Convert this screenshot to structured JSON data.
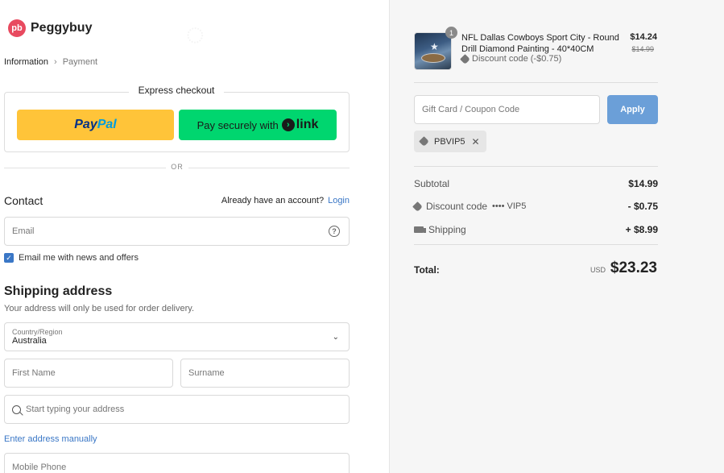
{
  "brand": {
    "name": "Peggybuy",
    "mark": "pb"
  },
  "breadcrumb": {
    "step1": "Information",
    "step2": "Payment"
  },
  "express": {
    "title": "Express checkout",
    "paypal_part1": "Pay",
    "paypal_part2": "Pal",
    "link_label": "Pay securely with",
    "link_word": "link"
  },
  "divider_label": "OR",
  "contact": {
    "heading": "Contact",
    "account_prompt": "Already have an account?",
    "login_label": "Login",
    "email_placeholder": "Email",
    "newsletter_label": "Email me with news and offers"
  },
  "shipping": {
    "heading": "Shipping address",
    "subtitle": "Your address will only be used for order delivery.",
    "country_label": "Country/Region",
    "country_value": "Australia",
    "first_name_placeholder": "First Name",
    "surname_placeholder": "Surname",
    "address_placeholder": "Start typing your address",
    "manual_link": "Enter address manually",
    "phone_placeholder": "Mobile Phone"
  },
  "order": {
    "quantity": "1",
    "product_name": "NFL Dallas Cowboys Sport City - Round Drill Diamond Painting - 40*40CM",
    "product_discount": "Discount code (-$0.75)",
    "price_now": "$14.24",
    "price_was": "$14.99",
    "gift_placeholder": "Gift Card / Coupon Code",
    "apply_label": "Apply",
    "applied_code": "PBVIP5",
    "subtotal_label": "Subtotal",
    "subtotal_value": "$14.99",
    "discount_label": "Discount code",
    "discount_code_masked": "•••• VIP5",
    "discount_value": "- $0.75",
    "shipping_label": "Shipping",
    "shipping_value": "+ $8.99",
    "total_label": "Total:",
    "total_currency": "USD",
    "total_value": "$23.23"
  },
  "colors": {
    "accent": "#3a77c6",
    "paypal_yellow": "#ffc439",
    "link_green": "#00d66f",
    "apply_blue": "#6b9fd8",
    "brand_red": "#e84a5f"
  }
}
